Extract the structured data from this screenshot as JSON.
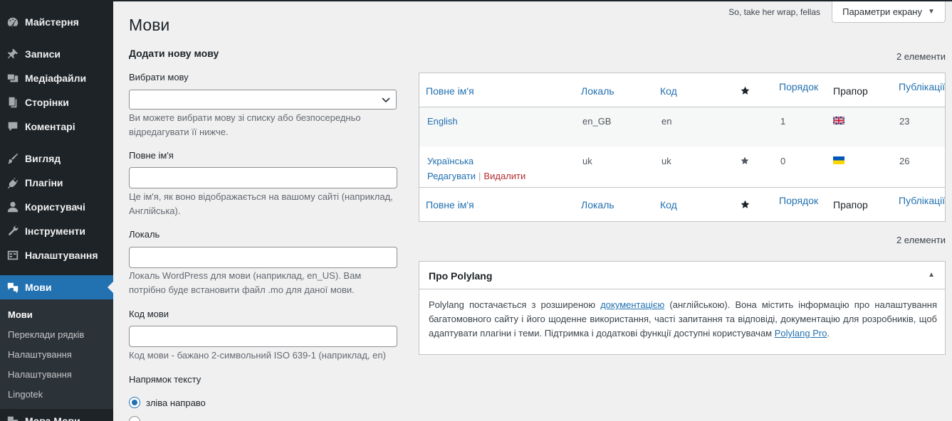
{
  "sidebar": {
    "items": [
      {
        "label": "Майстерня",
        "icon": "dashboard-icon"
      },
      {
        "label": "Записи",
        "icon": "pin-icon"
      },
      {
        "label": "Медіафайли",
        "icon": "media-icon"
      },
      {
        "label": "Сторінки",
        "icon": "page-icon"
      },
      {
        "label": "Коментарі",
        "icon": "comment-icon"
      },
      {
        "label": "Вигляд",
        "icon": "brush-icon"
      },
      {
        "label": "Плагіни",
        "icon": "plugin-icon"
      },
      {
        "label": "Користувачі",
        "icon": "user-icon"
      },
      {
        "label": "Інструменти",
        "icon": "wrench-icon"
      },
      {
        "label": "Налаштування",
        "icon": "settings-icon"
      },
      {
        "label": "Мови",
        "icon": "translation-icon"
      }
    ],
    "submenu": [
      "Мови",
      "Переклади рядків",
      "Налаштування",
      "Налаштування",
      "Lingotek"
    ],
    "partial_item": "Мова Мови"
  },
  "header": {
    "howdy": "So, take her wrap, fellas",
    "screen_options": "Параметри екрану"
  },
  "page": {
    "title": "Мови",
    "form_title": "Додати нову мову"
  },
  "form": {
    "choose_lang_label": "Вибрати мову",
    "choose_lang_desc": "Ви можете вибрати мову зі списку або безпосередньо відредагувати її нижче.",
    "full_name_label": "Повне ім'я",
    "full_name_desc": "Це ім'я, як воно відображається на вашому сайті (наприклад, Англійська).",
    "locale_label": "Локаль",
    "locale_desc": "Локаль WordPress для мови (наприклад, en_US). Вам потрібно буде встановити файл .mo для даної мови.",
    "code_label": "Код мови",
    "code_desc": "Код мови - бажано 2-символьний ISO 639-1 (наприклад, en)",
    "direction_label": "Напрямок тексту",
    "direction_ltr": "зліва направо"
  },
  "table": {
    "count_top": "2 елементи",
    "count_bottom": "2 елементи",
    "headers": {
      "full_name": "Повне ім'я",
      "locale": "Локаль",
      "code": "Код",
      "order": "Порядок",
      "flag": "Прапор",
      "posts": "Публікації"
    },
    "rows": [
      {
        "name": "English",
        "locale": "en_GB",
        "code": "en",
        "default": false,
        "order": "1",
        "flag": "uk-flag-icon",
        "posts": "23"
      },
      {
        "name": "Українська",
        "locale": "uk",
        "code": "uk",
        "default": true,
        "order": "0",
        "flag": "ukraine-flag-icon",
        "posts": "26"
      }
    ],
    "row_actions": {
      "edit": "Редагувати",
      "delete": "Видалити"
    }
  },
  "postbox": {
    "title": "Про Polylang",
    "text_1": "Polylang постачається з розширеною ",
    "link_1": "документацією",
    "text_2": " (англійською). Вона містить інформацію про налаштування багатомовного сайту і його щоденне використання, часті запитання та відповіді, документацію для розробників, щоб адаптувати плагіни і теми. Підтримка і додаткові функції доступні користувачам ",
    "link_2": "Polylang Pro",
    "text_3": "."
  },
  "colors": {
    "sidebar_bg": "#1d2327",
    "accent": "#2271b1",
    "delete": "#b32d2e"
  }
}
